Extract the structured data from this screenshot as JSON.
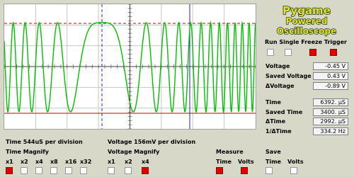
{
  "app": {
    "logo": {
      "line1": "Pygame",
      "line2": "Powered",
      "line3": "Oscilloscope"
    }
  },
  "scope": {
    "colors": {
      "background": "#ffffff",
      "grid": "#c8c8c8",
      "axis": "#404040",
      "trace": "#00c000",
      "cursor_voltage": "#d00000",
      "cursor_time": "#2020c0"
    }
  },
  "controls": {
    "labels": [
      "Run",
      "Single",
      "Freeze",
      "Trigger"
    ],
    "states": [
      false,
      false,
      true,
      true
    ]
  },
  "readouts": {
    "voltage": {
      "label": "Voltage",
      "value": "-0.45 V"
    },
    "saved_voltage": {
      "label": "Saved Voltage",
      "value": "0.43 V"
    },
    "delta_voltage": {
      "label": "ΔVoltage",
      "value": "-0.89 V"
    },
    "time": {
      "label": "Time",
      "value": "6392. µS"
    },
    "saved_time": {
      "label": "Saved Time",
      "value": "3400. µS"
    },
    "delta_time": {
      "label": "ΔTime",
      "value": "2992. µS"
    },
    "inv_delta_time": {
      "label": "1/ΔTime",
      "value": "334.2 Hz"
    }
  },
  "bottom": {
    "time_div": "Time 544uS per division",
    "voltage_div": "Voltage 156mV per division",
    "time_magnify": {
      "title": "Time Magnify",
      "options": [
        "x1",
        "x2",
        "x4",
        "x8",
        "x16",
        "x32"
      ],
      "selected_index": 0
    },
    "voltage_magnify": {
      "title": "Voltage Magnify",
      "options": [
        "x1",
        "x2",
        "x4"
      ],
      "selected_index": 2
    },
    "measure": {
      "title": "Measure",
      "options": [
        "Time",
        "Volts"
      ],
      "states": [
        true,
        true
      ]
    },
    "save": {
      "title": "Save",
      "options": [
        "Time",
        "Volts"
      ],
      "states": [
        false,
        false
      ]
    }
  }
}
